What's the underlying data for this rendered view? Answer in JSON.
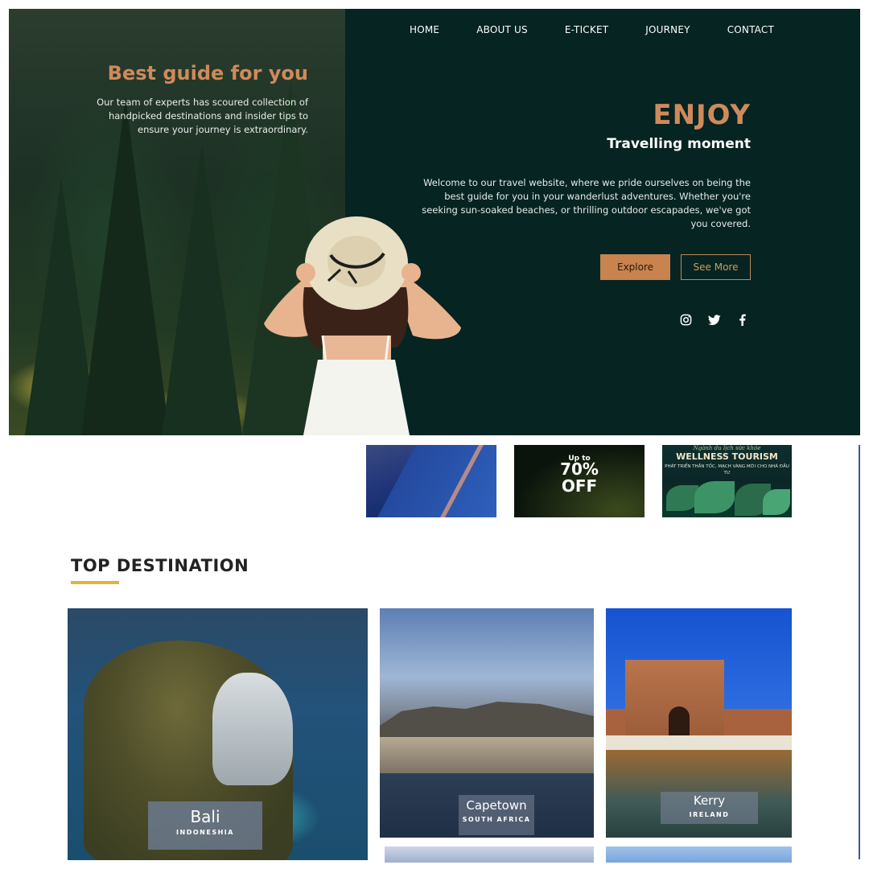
{
  "nav": {
    "items": [
      "HOME",
      "ABOUT US",
      "E-TICKET",
      "JOURNEY",
      "CONTACT"
    ]
  },
  "hero_left": {
    "title": "Best guide for you",
    "text": "Our team of experts has scoured collection of handpicked destinations and insider tips to ensure your journey is extraordinary."
  },
  "hero_right": {
    "title": "ENJOY",
    "subtitle": "Travelling moment",
    "text": "Welcome to our travel website, where we pride ourselves on being the best guide for you in your wanderlust adventures. Whether you're seeking sun-soaked beaches, or thrilling outdoor escapades, we've got you covered.",
    "explore_label": "Explore",
    "see_more_label": "See More"
  },
  "socials": [
    "instagram-icon",
    "twitter-icon",
    "facebook-icon"
  ],
  "promos": {
    "offer_upto": "Up to",
    "offer_pct": "70%",
    "offer_off": "OFF",
    "wellness_kicker": "Ngành du lịch sức khỏe",
    "wellness_title": "WELLNESS TOURISM",
    "wellness_sub": "PHÁT TRIỂN THẦN TỐC, MẠCH VÀNG MỚI CHO NHÀ ĐẦU TƯ"
  },
  "top_destination": {
    "title": "TOP DESTINATION",
    "cards": [
      {
        "city": "Bali",
        "country": "INDONESHIA"
      },
      {
        "city": "Capetown",
        "country": "SOUTH AFRICA"
      },
      {
        "city": "Kerry",
        "country": "IRELAND"
      }
    ]
  },
  "colors": {
    "hero_bg": "#052422",
    "accent": "#c8834f",
    "section_bar": "#e6b03a"
  }
}
